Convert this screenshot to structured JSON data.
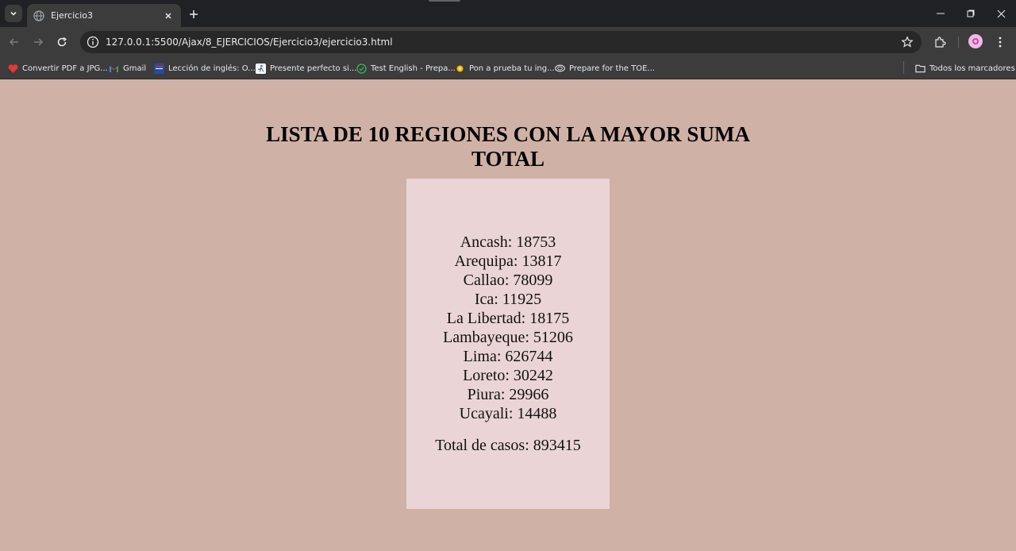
{
  "browser": {
    "tab": {
      "title": "Ejercicio3"
    },
    "url": "127.0.0.1:5500/Ajax/8_EJERCICIOS/Ejercicio3/ejercicio3.html",
    "bookmarks": [
      {
        "label": "Convertir PDF a JPG...",
        "icon": "pdf-heart-icon",
        "color": "#e53935"
      },
      {
        "label": "Gmail",
        "icon": "gmail-icon",
        "color": "#ea4335"
      },
      {
        "label": "Lección de inglés: O...",
        "icon": "flag-icon",
        "color": "#1e4ea3"
      },
      {
        "label": "Presente perfecto si...",
        "icon": "runner-icon",
        "color": "#3b6fd1"
      },
      {
        "label": "Test English - Prepa...",
        "icon": "check-circle-icon",
        "color": "#34a853"
      },
      {
        "label": "Pon a prueba tu ing...",
        "icon": "sun-icon",
        "color": "#f5b400"
      },
      {
        "label": "Prepare for the TOE...",
        "icon": "ets-icon",
        "color": "#d8d8d8"
      }
    ],
    "all_bookmarks_label": "Todos los marcadores"
  },
  "page": {
    "heading": "LISTA DE 10 REGIONES CON LA MAYOR SUMA TOTAL",
    "regions": [
      "Ancash: 18753",
      "Arequipa: 13817",
      "Callao: 78099",
      "Ica: 11925",
      "La Libertad: 18175",
      "Lambayeque: 51206",
      "Lima: 626744",
      "Loreto: 30242",
      "Piura: 29966",
      "Ucayali: 14488"
    ],
    "total": "Total de casos: 893415"
  }
}
